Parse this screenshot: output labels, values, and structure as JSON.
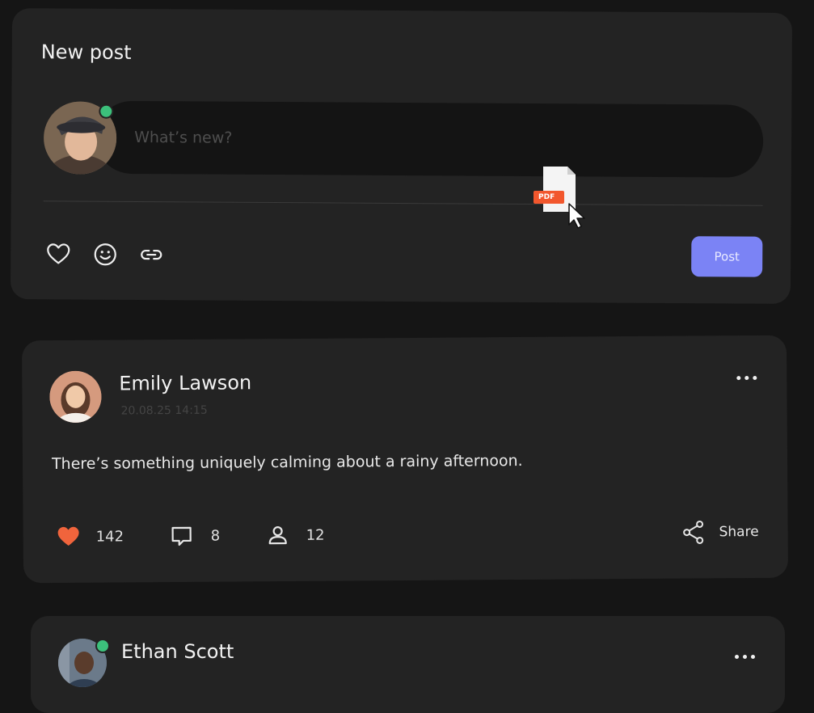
{
  "new_post": {
    "title": "New post",
    "input_placeholder": "What’s new?",
    "tools": [
      "heart-icon",
      "smiley-icon",
      "link-icon"
    ],
    "post_label": "Post",
    "drag_file_label": "PDF"
  },
  "posts": [
    {
      "author": "Emily Lawson",
      "timestamp": "20.08.25 14:15",
      "text": "There’s something uniquely calming about a rainy afternoon.",
      "likes": "142",
      "comments": "8",
      "followers": "12",
      "share_label": "Share"
    },
    {
      "author": "Ethan Scott"
    }
  ],
  "colors": {
    "accent": "#7b83f5",
    "like": "#f0643c",
    "online": "#3cc07b",
    "pdf_badge": "#f2572d"
  }
}
